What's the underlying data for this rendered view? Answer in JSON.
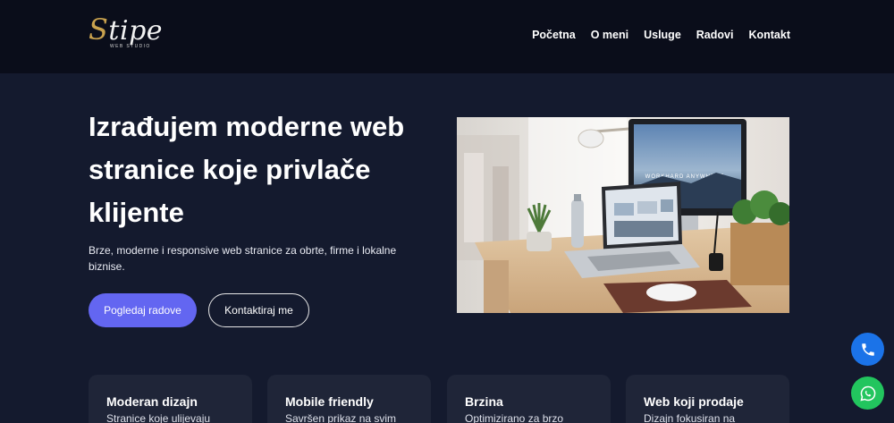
{
  "header": {
    "logo_text": "Stipe",
    "logo_subtitle": "WEB STUDIO",
    "nav": [
      {
        "label": "Početna"
      },
      {
        "label": "O meni"
      },
      {
        "label": "Usluge"
      },
      {
        "label": "Radovi"
      },
      {
        "label": "Kontakt"
      }
    ]
  },
  "hero": {
    "title": "Izrađujem moderne web stranice koje privlače klijente",
    "subtitle": "Brze, moderne i responsive web stranice za obrte, firme i lokalne biznise.",
    "primary_button": "Pogledaj radove",
    "secondary_button": "Kontaktiraj me",
    "image": {
      "screen_heading": "WORKHARD ANYWHERE"
    }
  },
  "features": [
    {
      "title": "Moderan dizajn",
      "text": "Stranice koje ulijevaju"
    },
    {
      "title": "Mobile friendly",
      "text": "Savršen prikaz na svim"
    },
    {
      "title": "Brzina",
      "text": "Optimizirano za brzo"
    },
    {
      "title": "Web koji prodaje",
      "text": "Dizajn fokusiran na"
    }
  ],
  "floating": {
    "phone_icon": "phone-icon",
    "whatsapp_icon": "whatsapp-icon"
  },
  "colors": {
    "header_bg": "#0a0d1a",
    "page_bg": "#141a2e",
    "card_bg": "#1f2538",
    "accent": "#6366f1",
    "logo_gold": "#c9a24e",
    "phone_blue": "#1b73e8",
    "whatsapp_green": "#22c55e"
  }
}
